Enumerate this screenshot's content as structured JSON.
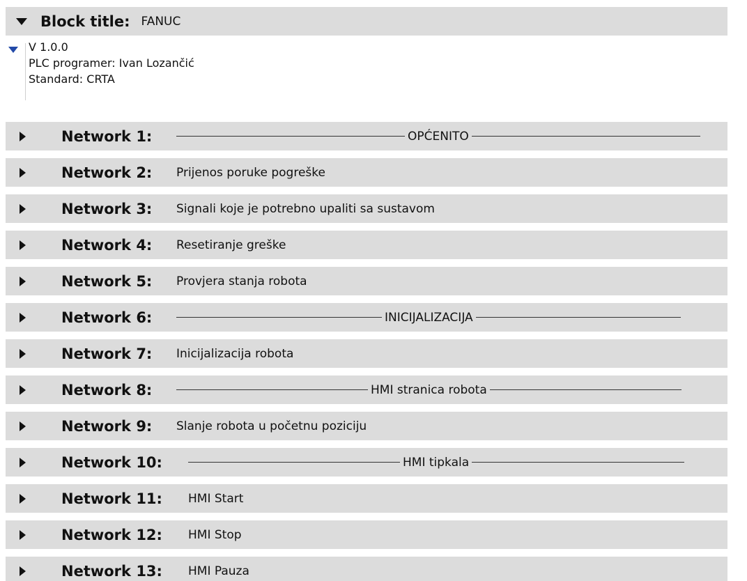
{
  "block": {
    "title_label": "Block title:",
    "title_value": "FANUC"
  },
  "comment": {
    "lines": [
      "V 1.0.0",
      "PLC programer: Ivan Lozančić",
      "Standard: CRTA"
    ]
  },
  "networks": [
    {
      "label": "Network 1:",
      "title": "OPĆENITO",
      "separator": true
    },
    {
      "label": "Network 2:",
      "title": "Prijenos poruke pogreške",
      "separator": false
    },
    {
      "label": "Network 3:",
      "title": "Signali koje je potrebno upaliti sa sustavom",
      "separator": false
    },
    {
      "label": "Network 4:",
      "title": "Resetiranje greške",
      "separator": false
    },
    {
      "label": "Network 5:",
      "title": "Provjera stanja robota",
      "separator": false
    },
    {
      "label": "Network 6:",
      "title": "INICIJALIZACIJA",
      "separator": true
    },
    {
      "label": "Network 7:",
      "title": "Inicijalizacija robota",
      "separator": false
    },
    {
      "label": "Network 8:",
      "title": "HMI stranica robota",
      "separator": true
    },
    {
      "label": "Network 9:",
      "title": "Slanje robota u početnu poziciju",
      "separator": false
    },
    {
      "label": "Network 10:",
      "title": "HMI tipkala",
      "separator": true
    },
    {
      "label": "Network 11:",
      "title": "HMI Start",
      "separator": false
    },
    {
      "label": "Network 12:",
      "title": "HMI Stop",
      "separator": false
    },
    {
      "label": "Network 13:",
      "title": "HMI Pauza",
      "separator": false
    }
  ]
}
